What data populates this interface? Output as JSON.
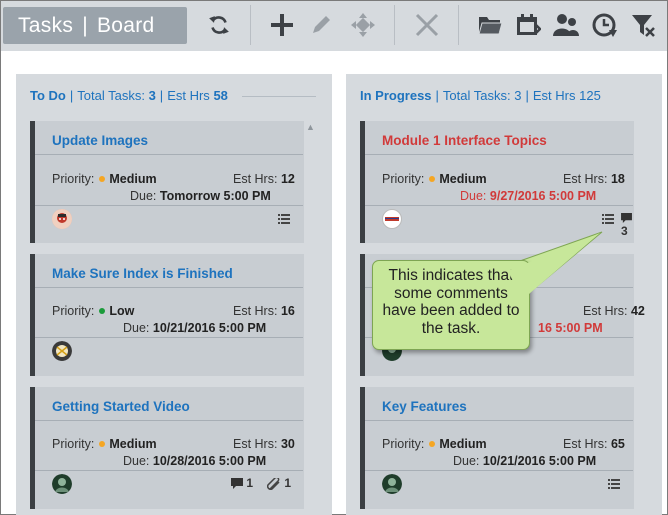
{
  "header": {
    "tasks_label": "Tasks",
    "separator": "|",
    "board_label": "Board"
  },
  "columns": [
    {
      "title": "To Do",
      "total_label": "Total Tasks:",
      "total_value": "3",
      "hrs_label": "Est Hrs",
      "hrs_value": "58",
      "cards": [
        {
          "title": "Update Images",
          "priority_label": "Priority:",
          "priority": "Medium",
          "priority_color": "#f5a623",
          "est_label": "Est Hrs:",
          "est_value": "12",
          "due_label": "Due:",
          "due_value": "Tomorrow 5:00 PM"
        },
        {
          "title": "Make Sure Index is Finished",
          "priority_label": "Priority:",
          "priority": "Low",
          "priority_color": "#1a9b3a",
          "est_label": "Est Hrs:",
          "est_value": "16",
          "due_label": "Due:",
          "due_value": "10/21/2016 5:00 PM"
        },
        {
          "title": "Getting Started Video",
          "priority_label": "Priority:",
          "priority": "Medium",
          "priority_color": "#f5a623",
          "est_label": "Est Hrs:",
          "est_value": "30",
          "due_label": "Due:",
          "due_value": "10/28/2016 5:00 PM",
          "comments": "1",
          "attachments": "1"
        }
      ]
    },
    {
      "title": "In Progress",
      "total_label": "Total Tasks:",
      "total_value": "3",
      "hrs_label": "Est Hrs",
      "hrs_value": "125",
      "cards": [
        {
          "title": "Module 1 Interface Topics",
          "priority_label": "Priority:",
          "priority": "Medium",
          "priority_color": "#f5a623",
          "est_label": "Est Hrs:",
          "est_value": "18",
          "due_label": "Due:",
          "due_value": "9/27/2016 5:00 PM",
          "comments": "3"
        },
        {
          "est_label": "Est Hrs:",
          "est_value": "42",
          "due_value": "16 5:00 PM"
        },
        {
          "title": "Key Features",
          "priority_label": "Priority:",
          "priority": "Medium",
          "priority_color": "#f5a623",
          "est_label": "Est Hrs:",
          "est_value": "65",
          "due_label": "Due:",
          "due_value": "10/21/2016 5:00 PM"
        }
      ]
    }
  ],
  "callout": {
    "line1": "This indicates that",
    "line2": "some comments",
    "line3": "have been added to",
    "line4": "the task."
  },
  "icons": [
    "refresh-icon",
    "plus-icon",
    "pencil-icon",
    "move-icon",
    "close-icon",
    "folder-icon",
    "calendar-icon",
    "users-icon",
    "clock-icon",
    "filter-clear-icon"
  ]
}
